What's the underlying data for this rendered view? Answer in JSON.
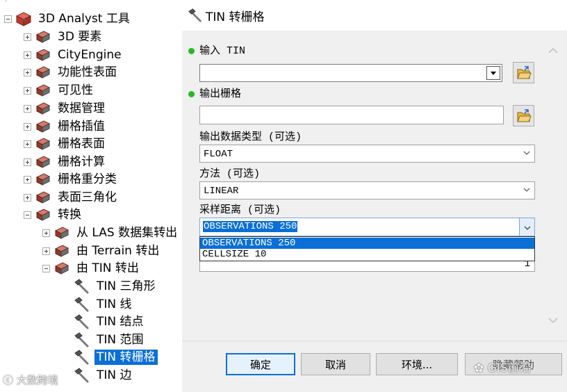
{
  "tree": {
    "root": "3D Analyst 工具",
    "items": [
      {
        "label": "3D 要素"
      },
      {
        "label": "CityEngine"
      },
      {
        "label": "功能性表面"
      },
      {
        "label": "可见性"
      },
      {
        "label": "数据管理"
      },
      {
        "label": "栅格插值"
      },
      {
        "label": "栅格表面"
      },
      {
        "label": "栅格计算"
      },
      {
        "label": "栅格重分类"
      },
      {
        "label": "表面三角化"
      },
      {
        "label": "转换"
      }
    ],
    "conversion_children": [
      {
        "label": "从 LAS 数据集转出"
      },
      {
        "label": "由 Terrain 转出"
      },
      {
        "label": "由 TIN 转出"
      }
    ],
    "tools": [
      {
        "label": "TIN 三角形"
      },
      {
        "label": "TIN 线"
      },
      {
        "label": "TIN 结点"
      },
      {
        "label": "TIN 范围"
      },
      {
        "label": "TIN 转栅格"
      },
      {
        "label": "TIN 边"
      }
    ]
  },
  "dialog": {
    "title": "TIN 转栅格",
    "fields": {
      "input_tin": {
        "label": "输入 TIN",
        "value": ""
      },
      "output_raster": {
        "label": "输出栅格",
        "value": ""
      },
      "output_data_type": {
        "label": "输出数据类型 (可选)",
        "value": "FLOAT"
      },
      "method": {
        "label": "方法 (可选)",
        "value": "LINEAR"
      },
      "sampling_distance": {
        "label": "采样距离 (可选)",
        "value": "OBSERVATIONS 250",
        "options": [
          "OBSERVATIONS 250",
          "CELLSIZE 10"
        ]
      },
      "z_factor": {
        "value": "1"
      }
    },
    "buttons": {
      "ok": "确定",
      "cancel": "取消",
      "environments": "环境...",
      "hide_help": "隐藏帮助"
    }
  },
  "watermarks": {
    "left": "大数跨境",
    "right": "GIS前沿"
  },
  "colors": {
    "selection": "#0a6fd6",
    "required_dot": "#22bb22",
    "dialog_bg": "#f0f0f0"
  }
}
